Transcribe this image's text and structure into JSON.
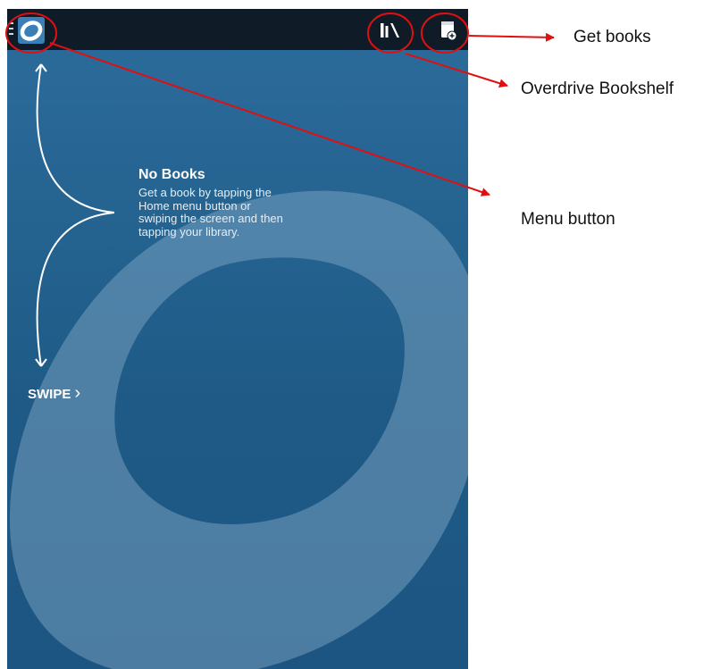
{
  "empty_state": {
    "title": "No Books",
    "body": "Get a book by tapping the Home menu button or swiping the screen and then tapping your library."
  },
  "swipe": {
    "label": "SWIPE",
    "chevron": "›"
  },
  "toolbar": {
    "menu_icon": "hamburger-icon",
    "logo_icon": "overdrive-logo-icon",
    "bookshelf_icon": "bookshelf-icon",
    "get_books_icon": "add-book-icon"
  },
  "annotations": {
    "get_books": "Get books",
    "bookshelf": "Overdrive Bookshelf",
    "menu": "Menu button"
  },
  "colors": {
    "topbar": "#0f1c28",
    "screen_top": "#2c6c9c",
    "screen_bottom": "#1d5582",
    "annotation_red": "#e01010"
  }
}
